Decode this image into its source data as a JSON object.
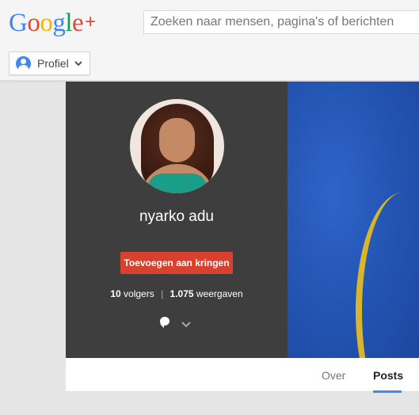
{
  "header": {
    "logo_letters": [
      "G",
      "o",
      "o",
      "g",
      "l",
      "e"
    ],
    "logo_colors": [
      "#4285f4",
      "#dd4b39",
      "#f4b400",
      "#4285f4",
      "#0f9d58",
      "#dd4b39"
    ],
    "logo_plus": "+",
    "search_placeholder": "Zoeken naar mensen, pagina's of berichten"
  },
  "subbar": {
    "profile_label": "Profiel"
  },
  "profile": {
    "name": "nyarko adu",
    "add_button": "Toevoegen aan kringen",
    "followers_count": "10",
    "followers_label": "volgers",
    "separator": "|",
    "views_count": "1.075",
    "views_label": "weergaven"
  },
  "tabs": {
    "over": "Over",
    "posts": "Posts"
  },
  "colors": {
    "accent": "#4285f4",
    "add_button": "#d9412f",
    "panel": "#3e3e3e"
  }
}
